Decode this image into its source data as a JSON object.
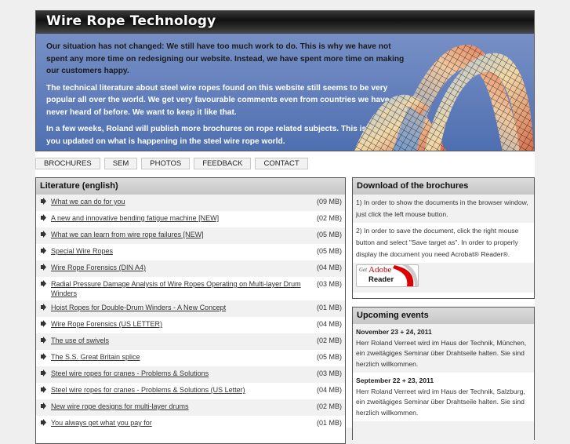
{
  "header": {
    "title": "Wire Rope Technology",
    "intro": [
      "Our situation has not changed: We still have too much work to do. This is why we have not spent any more time on redesigning our website. Instead, we have spent more time on making our customers happy.",
      "The technical literature about steel wire ropes found on this website still seems to be very popular all over the world. We get very favourable comments even from countries we have never heard of before. We want to keep it like that.",
      "In a few weeks, Roland will publish more brochures on rope related subjects. This is to keep you updated on what is happening in the steel wire rope world."
    ]
  },
  "nav": {
    "items": [
      "BROCHURES",
      "SEM",
      "PHOTOS",
      "FEEDBACK",
      "CONTACT"
    ]
  },
  "literature": {
    "title": "Literature (english)",
    "items": [
      {
        "label": "What we can do for you",
        "size": "(09 MB)"
      },
      {
        "label": "A new and innovative bending fatigue machine [NEW]",
        "size": "(02 MB)"
      },
      {
        "label": "What we can learn from wire rope failures [NEW]",
        "size": "(05 MB)"
      },
      {
        "label": "Special Wire Ropes",
        "size": "(05 MB)"
      },
      {
        "label": "Wire Rope Forensics (DIN A4)",
        "size": "(04 MB)"
      },
      {
        "label": "Radial Pressure Damage Analysis of Wire Ropes Operating on Multi-layer Drum Winders",
        "size": "(03 MB)"
      },
      {
        "label": "Hoist Ropes for Double-Drum Winders - A New Concept",
        "size": "(01 MB)"
      },
      {
        "label": "Wire Rope Forensics (US LETTER)",
        "size": "(04 MB)"
      },
      {
        "label": "The use of swivels",
        "size": "(02 MB)"
      },
      {
        "label": "The S.S. Great Britain splice",
        "size": "(05 MB)"
      },
      {
        "label": "Steel wire ropes for cranes - Problems & Solutions",
        "size": "(03 MB)"
      },
      {
        "label": "Steel wire ropes for cranes - Problems & Solutions (US Letter)",
        "size": "(04 MB)"
      },
      {
        "label": "New wire rope designs for multi-layer drums",
        "size": "(02 MB)"
      },
      {
        "label": "You always get what you pay for",
        "size": "(01 MB)"
      }
    ]
  },
  "download": {
    "title": "Download of the brochures",
    "step1": "1) In order to show the documents in the browser window, just click the left mouse button.",
    "step2": "2) In order to save the document, click the right mouse button and select \"Save target as\". In order to properly display the document you need Acrobat® Reader®.",
    "badge_get": "Get",
    "badge_adobe": "Adobe",
    "badge_reader": "Reader"
  },
  "events": {
    "title": "Upcoming events",
    "items": [
      {
        "date": "November 23 + 24, 2011",
        "text": "Herr Roland Verreet wird im Haus der Technik, München, ein zweitägiges Seminar über Drahtseile halten. Sie sind herzlich willkommen."
      },
      {
        "date": "September 22 + 23, 2011",
        "text": "Herr Roland Verreet wird im Haus der Technik, Salzburg, ein zweitägiges Seminar über Drahtseile halten. Sie sind herzlich willkommen."
      }
    ]
  }
}
